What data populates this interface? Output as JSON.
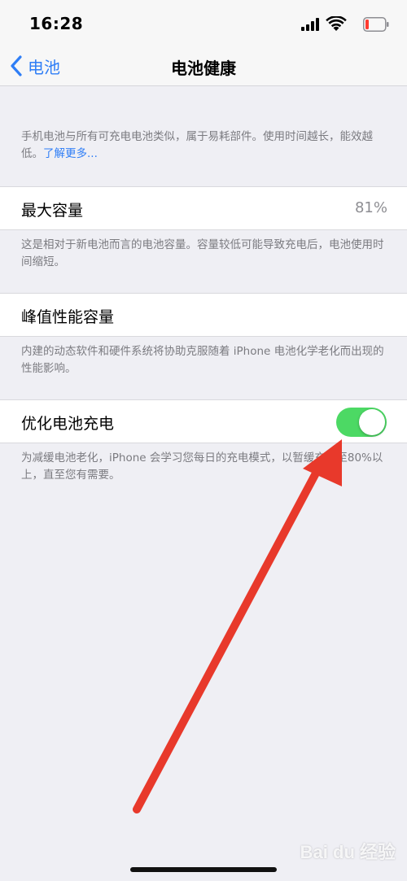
{
  "status_bar": {
    "time": "16:28",
    "icons": [
      "signal-icon",
      "wifi-icon",
      "battery-icon"
    ],
    "battery_color": "#ff3b30"
  },
  "nav": {
    "back_label": "电池",
    "title": "电池健康"
  },
  "intro": {
    "text": "手机电池与所有可充电电池类似，属于易耗部件。使用时间越长，能效越低。",
    "link": "了解更多..."
  },
  "max_capacity": {
    "label": "最大容量",
    "value": "81%",
    "footnote": "这是相对于新电池而言的电池容量。容量较低可能导致充电后，电池使用时间缩短。"
  },
  "peak_performance": {
    "label": "峰值性能容量",
    "footnote": "内建的动态软件和硬件系统将协助克服随着 iPhone 电池化学老化而出现的性能影响。"
  },
  "optimized_charging": {
    "label": "优化电池充电",
    "enabled": true,
    "footnote": "为减缓电池老化，iPhone 会学习您每日的充电模式，以暂缓充电至80%以上，直至您有需要。"
  },
  "colors": {
    "accent": "#2f7ef6",
    "toggle_on": "#4cd964",
    "annotation_arrow": "#e8392b",
    "background": "#efeff4"
  },
  "watermark": "Bai du 经验"
}
